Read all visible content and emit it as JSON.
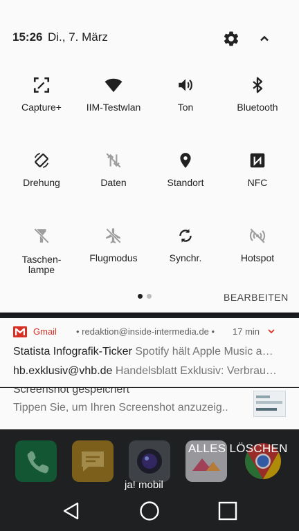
{
  "status": {
    "time": "15:26",
    "date": "Di., 7. März"
  },
  "header_icons": {
    "settings": "gear-icon",
    "collapse": "chevron-up-icon"
  },
  "tiles": [
    {
      "label": "Capture+",
      "icon": "capture-plus-icon",
      "active": true
    },
    {
      "label": "IIM-Testwlan",
      "icon": "wifi-icon",
      "active": true
    },
    {
      "label": "Ton",
      "icon": "volume-icon",
      "active": true
    },
    {
      "label": "Bluetooth",
      "icon": "bluetooth-icon",
      "active": true
    },
    {
      "label": "Drehung",
      "icon": "rotation-icon",
      "active": true
    },
    {
      "label": "Daten",
      "icon": "mobile-data-off-icon",
      "active": false
    },
    {
      "label": "Standort",
      "icon": "location-icon",
      "active": true
    },
    {
      "label": "NFC",
      "icon": "nfc-icon",
      "active": true
    },
    {
      "label": "Taschen-\nlampe",
      "icon": "flashlight-off-icon",
      "active": false
    },
    {
      "label": "Flugmodus",
      "icon": "airplane-off-icon",
      "active": false
    },
    {
      "label": "Synchr.",
      "icon": "sync-icon",
      "active": true
    },
    {
      "label": "Hotspot",
      "icon": "hotspot-off-icon",
      "active": false
    }
  ],
  "pager": {
    "pages": 2,
    "current": 1
  },
  "edit_label": "BEARBEITEN",
  "gmail": {
    "app": "Gmail",
    "sender": "redaktion@inside-intermedia.de",
    "time": "17 min",
    "rows": [
      {
        "bold": "Statista Infografik-Ticker",
        "text": "Spotify hält Apple Music a…"
      },
      {
        "bold": "hb.exklusiv@vhb.de",
        "text": "Handelsblatt Exklusiv: Verbrau…"
      }
    ]
  },
  "screenshot_notif": {
    "title": "Screenshot gespeichert",
    "body": "Tippen Sie, um Ihren Screenshot anzuzeig.."
  },
  "home": {
    "clear_all": "ALLES LÖSCHEN",
    "app_label": "ja! mobil"
  },
  "colors": {
    "gmail_red": "#d93025",
    "panel_bg": "#fafafa",
    "home_bg": "#1e2022"
  }
}
